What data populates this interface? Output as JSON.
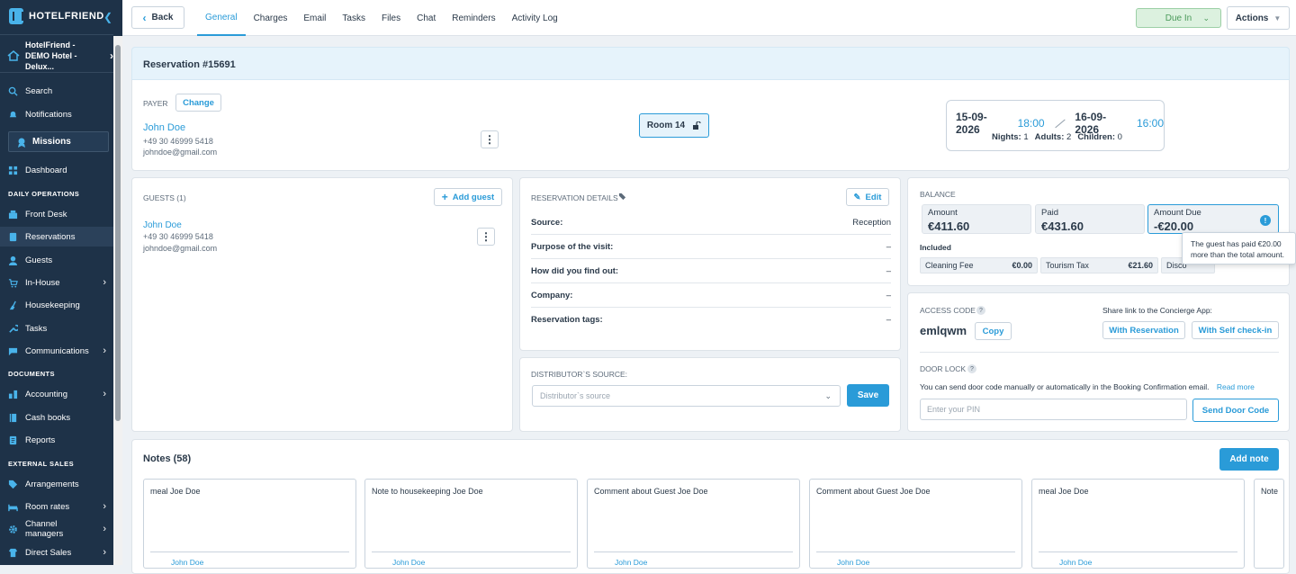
{
  "brand": {
    "name": "HOTELFRIEND",
    "accent": "#2a9bd8",
    "sidebar_bg": "#1e3248"
  },
  "sidebar": {
    "hotel_name": "HotelFriend - DEMO Hotel - Delux...",
    "search": "Search",
    "notifications": "Notifications",
    "missions": "Missions",
    "dashboard": "Dashboard",
    "sections": {
      "daily": "DAILY OPERATIONS",
      "documents": "DOCUMENTS",
      "external": "EXTERNAL SALES"
    },
    "items": {
      "front_desk": "Front Desk",
      "reservations": "Reservations",
      "guests": "Guests",
      "in_house": "In-House",
      "housekeeping": "Housekeeping",
      "tasks": "Tasks",
      "communications": "Communications",
      "accounting": "Accounting",
      "cash_books": "Cash books",
      "reports": "Reports",
      "arrangements": "Arrangements",
      "room_rates": "Room rates",
      "channel_managers": "Channel managers",
      "direct_sales": "Direct Sales"
    }
  },
  "topbar": {
    "back": "Back",
    "tabs": [
      "General",
      "Charges",
      "Email",
      "Tasks",
      "Files",
      "Chat",
      "Reminders",
      "Activity Log"
    ],
    "status": "Due In",
    "actions": "Actions"
  },
  "reservation": {
    "title": "Reservation #15691",
    "payer_label": "PAYER",
    "change": "Change",
    "payer_name": "John Doe",
    "payer_phone": "+49 30 46999 5418",
    "payer_email": "johndoe@gmail.com",
    "room": "Room 14",
    "arrival_date": "15-09-2026",
    "arrival_time": "18:00",
    "departure_date": "16-09-2026",
    "departure_time": "16:00",
    "nights_label": "Nights:",
    "nights": "1",
    "adults_label": "Adults:",
    "adults": "2",
    "children_label": "Children:",
    "children": "0"
  },
  "guests": {
    "title": "GUESTS (1)",
    "add": "Add guest",
    "name": "John Doe",
    "phone": "+49 30 46999 5418",
    "email": "johndoe@gmail.com"
  },
  "details": {
    "title": "RESERVATION DETAILS",
    "edit": "Edit",
    "rows": [
      {
        "label": "Source:",
        "value": "Reception"
      },
      {
        "label": "Purpose of the visit:",
        "value": "–"
      },
      {
        "label": "How did you find out:",
        "value": "–"
      },
      {
        "label": "Company:",
        "value": "–"
      },
      {
        "label": "Reservation tags:",
        "value": "–"
      }
    ]
  },
  "distributor": {
    "title": "DISTRIBUTOR`S SOURCE:",
    "placeholder": "Distributor`s source",
    "save": "Save"
  },
  "balance": {
    "title": "BALANCE",
    "amount_label": "Amount",
    "amount": "€411.60",
    "paid_label": "Paid",
    "paid": "€431.60",
    "due_label": "Amount Due",
    "due": "-€20.00",
    "included": "Included",
    "fees": [
      {
        "label": "Cleaning Fee",
        "value": "€0.00"
      },
      {
        "label": "Tourism Tax",
        "value": "€21.60"
      },
      {
        "label": "Disco",
        "value": ""
      }
    ],
    "tooltip": "The guest has paid €20.00 more than the total amount."
  },
  "access": {
    "title": "ACCESS CODE",
    "code": "emlqwm",
    "copy": "Copy",
    "share": "Share link to the Concierge App:",
    "with_reservation": "With Reservation",
    "with_self": "With Self check-in",
    "door_title": "DOOR LOCK",
    "door_text": "You can send door code manually or automatically in the Booking Confirmation email.",
    "read_more": "Read more",
    "pin_placeholder": "Enter your PIN",
    "send": "Send Door Code"
  },
  "notes": {
    "title": "Notes (58)",
    "add": "Add note",
    "items": [
      {
        "text": "meal Joe Doe",
        "author": "John Doe"
      },
      {
        "text": "Note to housekeeping Joe Doe",
        "author": "John Doe"
      },
      {
        "text": "Comment about Guest Joe Doe",
        "author": "John Doe"
      },
      {
        "text": "Comment about Guest Joe Doe",
        "author": "John Doe"
      },
      {
        "text": "meal Joe Doe",
        "author": "John Doe"
      },
      {
        "text": "Note",
        "author": ""
      }
    ]
  }
}
